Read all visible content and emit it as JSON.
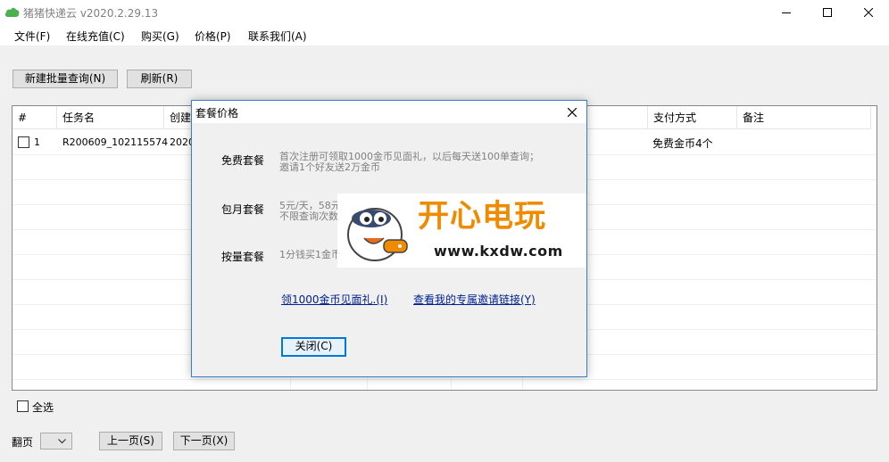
{
  "window": {
    "title": "猪猪快递云 v2020.2.29.13",
    "icon": "cloud-icon",
    "controls": [
      "minimize-icon",
      "maximize-icon",
      "close-icon"
    ]
  },
  "menu": [
    "文件(F)",
    "在线充值(C)",
    "购买(G)",
    "价格(P)",
    "联系我们(A)"
  ],
  "toolbar": {
    "new_batch_label": "新建批量查询(N)",
    "refresh_label": "刷新(R)"
  },
  "table": {
    "columns": [
      "#",
      "任务名",
      "创建",
      "支付方式",
      "备注"
    ],
    "rows": [
      {
        "index": "1",
        "task_name": "R200609_102115574",
        "created": "2020",
        "payment": "免费金币4个",
        "note": ""
      }
    ]
  },
  "footer": {
    "select_all_label": "全选",
    "page_label": "翻页",
    "page_value": "",
    "prev_label": "上一页(S)",
    "next_label": "下一页(X)"
  },
  "dialog": {
    "title": "套餐价格",
    "plans": [
      {
        "name": "免费套餐",
        "desc_line1": "首次注册可领取1000金币见面礼，以后每天送100单查询；",
        "desc_line2": "邀请1个好友送2万金币"
      },
      {
        "name": "包月套餐",
        "desc_line1": "5元/天，58元",
        "desc_line2": "不限查询次数"
      },
      {
        "name": "按量套餐",
        "desc_line1": "1分钱买1金币",
        "desc_line2": ""
      }
    ],
    "link_claim": "领1000金币见面礼.(I)",
    "link_invite": "查看我的专属邀请链接(Y)",
    "close_label": "关闭(C)"
  },
  "watermark": {
    "brand": "开心电玩",
    "url": "www.kxdw.com"
  },
  "colors": {
    "accent": "#0078d7",
    "link": "#00208f",
    "watermark_orange": "#f08a00",
    "app_icon_green": "#4caf50"
  }
}
